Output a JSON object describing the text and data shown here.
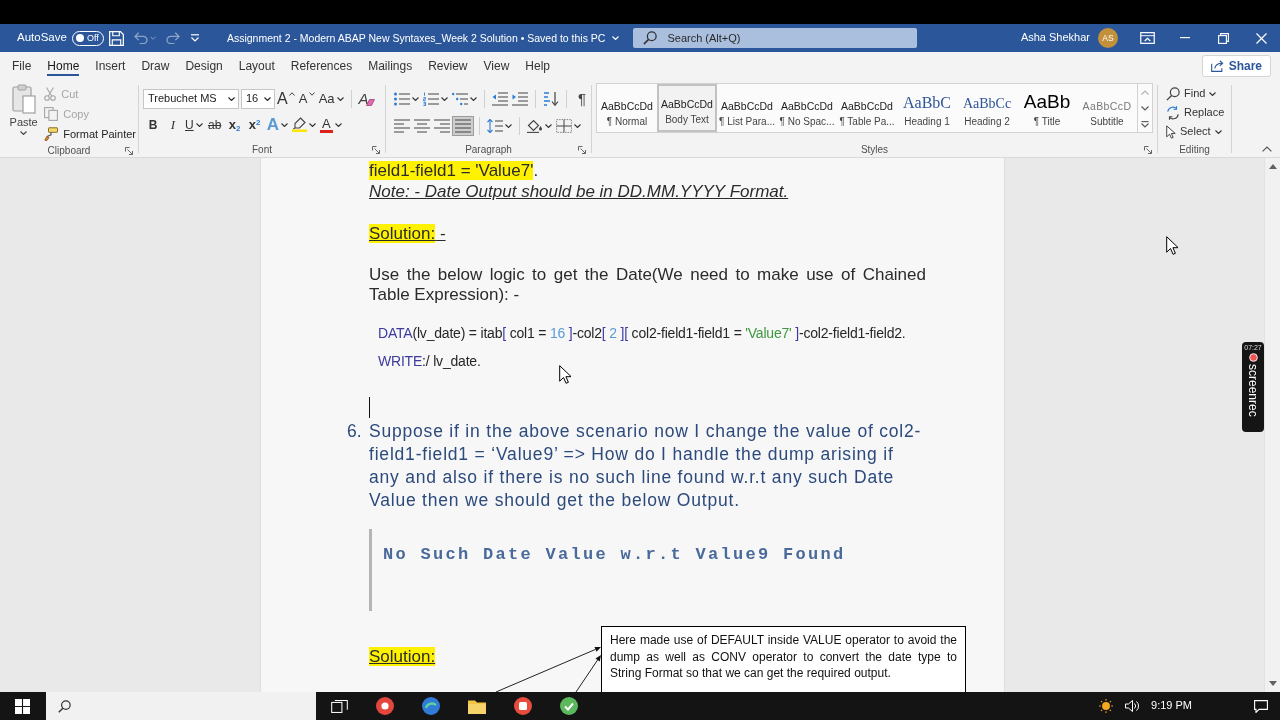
{
  "window": {
    "autosave": {
      "label": "AutoSave",
      "state": "Off",
      "on": false
    },
    "quick_access": [
      {
        "kind": "save",
        "disabled": false
      },
      {
        "kind": "undo",
        "disabled": true
      },
      {
        "kind": "redo",
        "disabled": true
      },
      {
        "kind": "customize",
        "disabled": false
      }
    ],
    "title": "Assignment 2 - Modern ABAP New Syntaxes_Week 2 Solution • Saved to this PC",
    "search": {
      "placeholder": "Search (Alt+Q)"
    },
    "user": {
      "name": "Asha Shekhar",
      "initials": "AS"
    }
  },
  "ribbon_tabs": [
    {
      "label": "File",
      "selected": false
    },
    {
      "label": "Home",
      "selected": true
    },
    {
      "label": "Insert",
      "selected": false
    },
    {
      "label": "Draw",
      "selected": false
    },
    {
      "label": "Design",
      "selected": false
    },
    {
      "label": "Layout",
      "selected": false
    },
    {
      "label": "References",
      "selected": false
    },
    {
      "label": "Mailings",
      "selected": false
    },
    {
      "label": "Review",
      "selected": false
    },
    {
      "label": "View",
      "selected": false
    },
    {
      "label": "Help",
      "selected": false
    }
  ],
  "share": {
    "label": "Share"
  },
  "ribbon": {
    "clipboard": {
      "label": "Clipboard",
      "launcher": true,
      "paste": "Paste",
      "tools": [
        {
          "kind": "cut",
          "label": "Cut",
          "disabled": true
        },
        {
          "kind": "copy",
          "label": "Copy",
          "disabled": true
        },
        {
          "kind": "format-painter",
          "label": "Format Painter",
          "disabled": false
        }
      ]
    },
    "font": {
      "label": "Font",
      "launcher": true,
      "name": "Trebuchet MS",
      "size": "16",
      "size_tools": [
        {
          "kind": "grow",
          "glyph": "A"
        },
        {
          "kind": "shrink",
          "glyph": "A"
        },
        {
          "kind": "change-case",
          "glyph": "Aa"
        },
        {
          "kind": "clear",
          "glyph": "A"
        }
      ],
      "format_tools": [
        {
          "kind": "bold",
          "glyph": "B"
        },
        {
          "kind": "italic",
          "glyph": "I"
        },
        {
          "kind": "underline",
          "glyph": "U"
        },
        {
          "kind": "strikethrough",
          "glyph": "ab"
        },
        {
          "kind": "subscript",
          "glyph": "x$_{2}$"
        },
        {
          "kind": "superscript",
          "glyph": "x$^{2}$"
        },
        {
          "kind": "text-effects",
          "glyph": "A"
        },
        {
          "kind": "highlight"
        },
        {
          "kind": "font-color",
          "glyph": "A"
        }
      ]
    },
    "paragraph": {
      "label": "Paragraph",
      "launcher": true,
      "marks_glyph": "¶",
      "alignment": [
        {
          "kind": "left",
          "selected": false
        },
        {
          "kind": "center",
          "selected": false
        },
        {
          "kind": "right",
          "selected": false
        },
        {
          "kind": "justify",
          "selected": true
        }
      ]
    },
    "styles": {
      "label": "Styles",
      "launcher": true,
      "items": [
        {
          "kind": "normal",
          "preview": "AaBbCcDd",
          "name": "¶ Normal",
          "selected": false
        },
        {
          "kind": "normal",
          "preview": "AaBbCcDd",
          "name": "Body Text",
          "selected": true
        },
        {
          "kind": "normal",
          "preview": "AaBbCcDd",
          "name": "¶ List Para...",
          "selected": false
        },
        {
          "kind": "normal",
          "preview": "AaBbCcDd",
          "name": "¶ No Spac...",
          "selected": false
        },
        {
          "kind": "normal",
          "preview": "AaBbCcDd",
          "name": "¶ Table Pa...",
          "selected": false
        },
        {
          "kind": "heading1",
          "preview": "AaBbC",
          "name": "Heading 1",
          "selected": false
        },
        {
          "kind": "heading2",
          "preview": "AaBbCc",
          "name": "Heading 2",
          "selected": false
        },
        {
          "kind": "title",
          "preview": "AaBb",
          "name": "¶ Title",
          "selected": false
        },
        {
          "kind": "subtitle",
          "preview": "AaBbCcD",
          "name": "Subtitle",
          "selected": false
        }
      ]
    },
    "editing": {
      "label": "Editing",
      "launcher": false,
      "tools": [
        {
          "kind": "find",
          "label": "Find"
        },
        {
          "kind": "replace",
          "label": "Replace"
        },
        {
          "kind": "select",
          "label": "Select"
        }
      ]
    }
  },
  "document": {
    "blocks": [
      {
        "kind": "highlighted-line",
        "runs": [
          {
            "text": "field1-field1 = 'Value7'",
            "highlight": true
          },
          {
            "text": ".",
            "highlight": false
          }
        ]
      },
      {
        "kind": "note",
        "text": "Note: - Date Output should be in DD.MM.YYYY Format."
      },
      {
        "kind": "blank"
      },
      {
        "kind": "heading",
        "runs": [
          {
            "text": "Solution:",
            "highlight": true
          },
          {
            "text": " -",
            "highlight": false
          }
        ]
      },
      {
        "kind": "blank"
      },
      {
        "kind": "paragraph",
        "text": "Use the below logic to get the Date(We need to make use of Chained Table Expression): -"
      },
      {
        "kind": "code",
        "lines": [
          [
            {
              "text": "DATA",
              "kind": "keyword"
            },
            {
              "text": "(lv_date) = itab",
              "kind": "plain"
            },
            {
              "text": "[",
              "kind": "keyword"
            },
            {
              "text": " col1 = ",
              "kind": "plain"
            },
            {
              "text": "16",
              "kind": "number"
            },
            {
              "text": " ]",
              "kind": "keyword"
            },
            {
              "text": "-col2",
              "kind": "plain"
            },
            {
              "text": "[ ",
              "kind": "keyword"
            },
            {
              "text": "2",
              "kind": "number"
            },
            {
              "text": " ][",
              "kind": "keyword"
            },
            {
              "text": " col2-field1-field1 = ",
              "kind": "plain"
            },
            {
              "text": "'Value7'",
              "kind": "string"
            },
            {
              "text": " ]",
              "kind": "keyword"
            },
            {
              "text": "-col2-field1-field2.",
              "kind": "plain"
            }
          ],
          [
            {
              "text": "WRITE",
              "kind": "keyword"
            },
            {
              "text": ":/ lv_date.",
              "kind": "plain"
            }
          ]
        ]
      },
      {
        "kind": "cursor"
      },
      {
        "kind": "list-item",
        "number": "6.",
        "text": "Suppose if in the above scenario now I change the value of col2-field1-field1 = ‘Value9’ => How do I handle the dump arising if any and also if there is no such line found w.r.t any such Date Value then we should get the below Output."
      },
      {
        "kind": "output",
        "text": "No Such Date Value w.r.t Value9 Found"
      },
      {
        "kind": "blank"
      },
      {
        "kind": "heading",
        "runs": [
          {
            "text": "Solution:",
            "highlight": true
          }
        ]
      }
    ],
    "callout": {
      "text": "Here made use of DEFAULT inside VALUE operator to avoid the dump as well as CONV operator to convert the date type to String Format so that we can get the required output."
    }
  },
  "recorder": {
    "time": "07:27",
    "label": "screenrec"
  },
  "taskbar": {
    "time": "9:19 PM"
  }
}
